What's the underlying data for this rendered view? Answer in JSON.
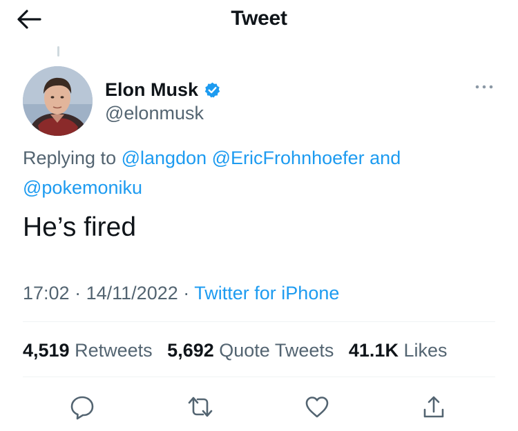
{
  "header": {
    "title": "Tweet",
    "back_icon": "arrow-left-icon"
  },
  "tweet": {
    "author": {
      "name": "Elon Musk",
      "handle": "@elonmusk",
      "verified": true,
      "verified_icon": "verified-badge-icon"
    },
    "replying": {
      "prefix": "Replying to",
      "mentions": [
        "@langdon",
        "@EricFrohnhoefer"
      ],
      "and_word": "and",
      "last_mention": "@pokemoniku"
    },
    "text": "He’s fired",
    "time": "17:02",
    "date": "14/11/2022",
    "separator": "·",
    "source": "Twitter for iPhone",
    "stats": {
      "retweets_count": "4,519",
      "retweets_label": "Retweets",
      "quotes_count": "5,692",
      "quotes_label": "Quote Tweets",
      "likes_count": "41.1K",
      "likes_label": "Likes"
    },
    "actions": [
      "reply-icon",
      "retweet-icon",
      "like-icon",
      "share-icon"
    ]
  },
  "colors": {
    "link": "#1d9bf0",
    "secondary_text": "#536471",
    "primary_text": "#0f1419",
    "divider": "#eff3f4"
  }
}
